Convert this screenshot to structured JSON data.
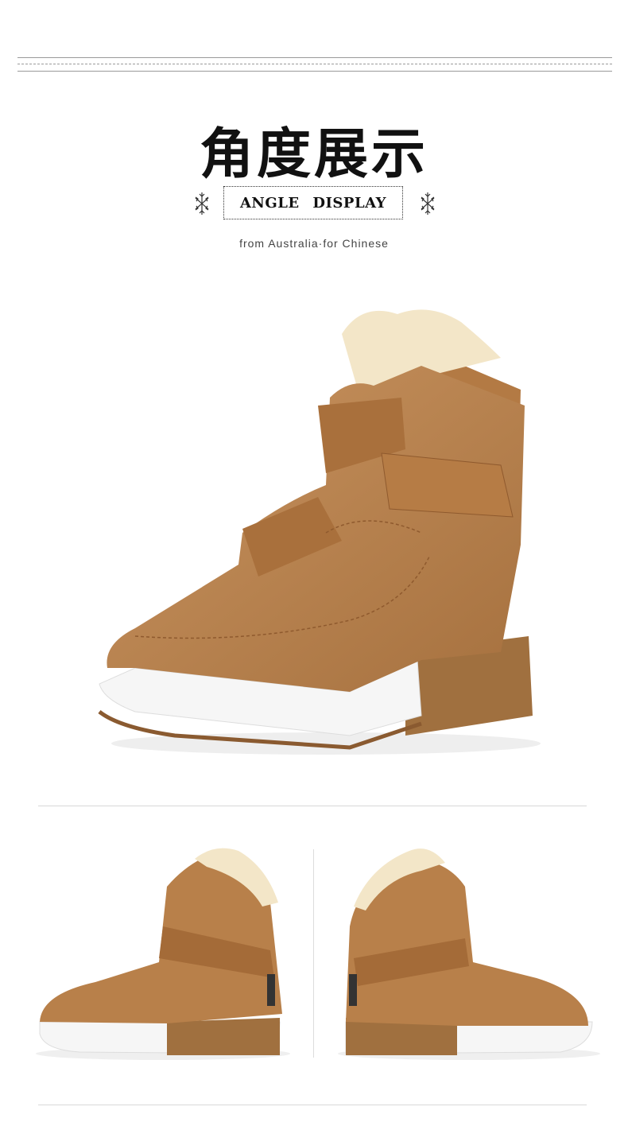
{
  "header": {
    "title_cn": "角度展示",
    "badge_text": "ANGLE DISPLAY",
    "subtitle": "from Australia·for Chinese"
  },
  "images": {
    "main": "suede high-top boot with shearling lining, angled front view",
    "left": "suede boot, outer side view",
    "right": "suede boot, inner side view"
  },
  "colors": {
    "suede": "#b8804a",
    "suede_dark": "#8f5a2e",
    "fur": "#f3e6c8",
    "sole_white": "#f5f5f5",
    "heel": "#a0703f"
  },
  "icons": {
    "left": "snowflake-icon",
    "right": "snowflake-icon"
  }
}
